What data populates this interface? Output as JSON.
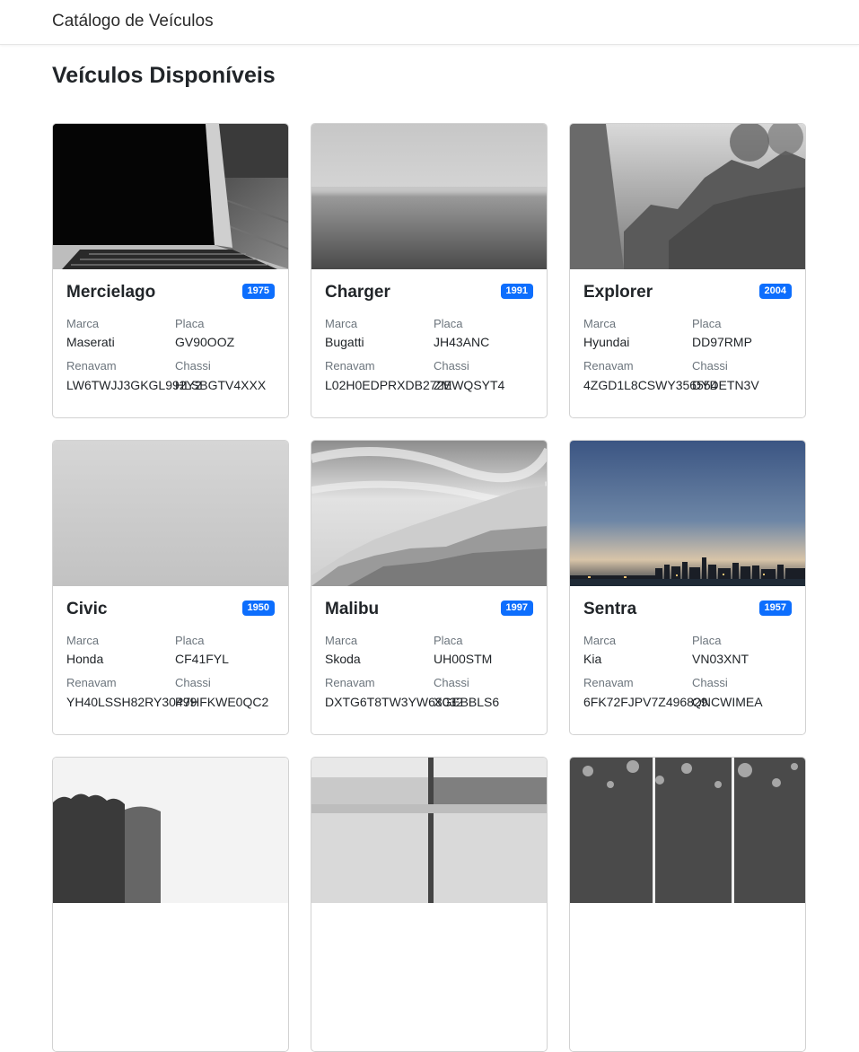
{
  "navbar": {
    "brand": "Catálogo de Veículos"
  },
  "page": {
    "title": "Veículos Disponíveis"
  },
  "labels": {
    "marca": "Marca",
    "placa": "Placa",
    "renavam": "Renavam",
    "chassi": "Chassi"
  },
  "vehicles": [
    {
      "model": "Mercielago",
      "year": "1975",
      "brand": "Maserati",
      "plate": "GV90OOZ",
      "renavam": "LW6TWJJ3GKGL992Y2",
      "chassi": "HLSBGTV4XXX"
    },
    {
      "model": "Charger",
      "year": "1991",
      "brand": "Bugatti",
      "plate": "JH43ANC",
      "renavam": "L02H0EDPRXDB272E",
      "chassi": "ZMWQSYT4"
    },
    {
      "model": "Explorer",
      "year": "2004",
      "brand": "Hyundai",
      "plate": "DD97RMP",
      "renavam": "4ZGD1L8CSWY356554",
      "chassi": "DYDETN3V"
    },
    {
      "model": "Civic",
      "year": "1950",
      "brand": "Honda",
      "plate": "CF41FYL",
      "renavam": "YH40LSSH82RY30499",
      "chassi": "P7HFKWE0QC2"
    },
    {
      "model": "Malibu",
      "year": "1997",
      "brand": "Skoda",
      "plate": "UH00STM",
      "renavam": "DXTG6T8TW3YW63032",
      "chassi": "XGEBBLS6"
    },
    {
      "model": "Sentra",
      "year": "1957",
      "brand": "Kia",
      "plate": "VN03XNT",
      "renavam": "6FK72FJPV7Z496829",
      "chassi": "QNCWIMEA"
    },
    {
      "model": "",
      "year": "",
      "brand": "",
      "plate": "",
      "renavam": "",
      "chassi": ""
    },
    {
      "model": "",
      "year": "",
      "brand": "",
      "plate": "",
      "renavam": "",
      "chassi": ""
    },
    {
      "model": "",
      "year": "",
      "brand": "",
      "plate": "",
      "renavam": "",
      "chassi": ""
    }
  ]
}
